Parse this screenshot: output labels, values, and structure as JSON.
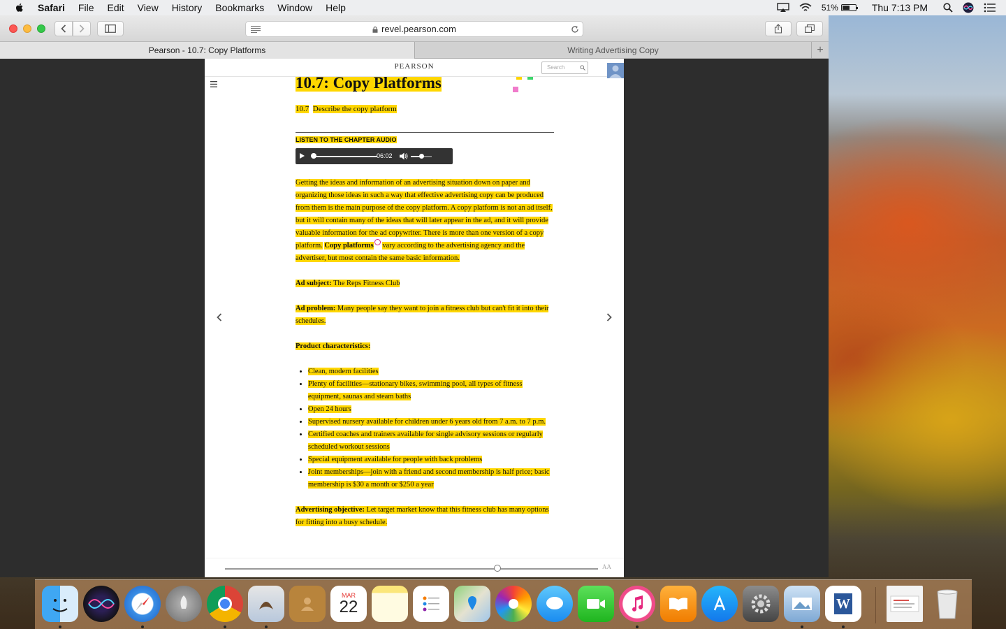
{
  "menubar": {
    "app_name": "Safari",
    "items": [
      "File",
      "Edit",
      "View",
      "History",
      "Bookmarks",
      "Window",
      "Help"
    ],
    "battery_percent": "51%",
    "battery_level": 0.51,
    "clock": "Thu 7:13 PM",
    "icons": [
      "apple-icon",
      "airplay-icon",
      "wifi-icon",
      "battery-icon",
      "spotlight-icon",
      "siri-icon",
      "notification-center-icon"
    ]
  },
  "browser": {
    "url": "revel.pearson.com",
    "tabs": [
      {
        "label": "Pearson - 10.7: Copy Platforms",
        "active": true
      },
      {
        "label": "Writing Advertising Copy",
        "active": false
      }
    ],
    "new_tab_label": "+"
  },
  "page": {
    "brand": "PEARSON",
    "search_placeholder": "Search",
    "title": "10.7: Copy Platforms",
    "objective_number": "10.7",
    "objective_text": "Describe the copy platform",
    "listen_label": "LISTEN TO THE CHAPTER AUDIO",
    "audio_time": "06:02",
    "audio_progress": 0.02,
    "volume_level": 0.5,
    "intro": {
      "part1": "Getting the ideas and information of an advertising situation down on paper and organizing those ideas in such a way that effective advertising copy can be produced from them is the main purpose of the copy platform. A copy platform is not an ad itself, but it will contain many of the ideas that will later appear in the ad, and it will provide valuable information for the ad copywriter. There is more than one version of a copy platform.",
      "term": "Copy platforms",
      "part2": "vary according to the advertising agency and the advertiser, but most contain the same basic information."
    },
    "ad_subject_label": "Ad subject:",
    "ad_subject_value": "The Reps Fitness Club",
    "ad_problem_label": "Ad problem:",
    "ad_problem_value": "Many people say they want to join a fitness club but can't fit it into their schedules.",
    "product_label": "Product characteristics:",
    "product_items": [
      "Clean, modern facilities",
      "Plenty of facilities—stationary bikes, swimming pool, all types of fitness equipment, saunas and steam baths",
      "Open 24 hours",
      "Supervised nursery available for children under 6 years old from 7 a.m. to 7 p.m.",
      "Certified coaches and trainers available for single advisory sessions or regularly scheduled workout sessions",
      "Special equipment available for people with back problems",
      "Joint memberships—join with a friend and second membership is half price; basic membership is $30 a month or $250 a year"
    ],
    "objective_label": "Advertising objective:",
    "objective_value": "Let target market know that this fitness club has many options for fitting into a busy schedule.",
    "reading_progress": 0.73,
    "font_size_label": "AA",
    "highlight_color": "#ffd700"
  },
  "dock": {
    "calendar_month": "MAR",
    "calendar_day": "22",
    "apps": [
      "Finder",
      "Siri",
      "Safari",
      "Launchpad",
      "Chrome",
      "Mail",
      "Contacts",
      "Calendar",
      "Notes",
      "Reminders",
      "Maps",
      "Photos",
      "Messages",
      "FaceTime",
      "iTunes",
      "iBooks",
      "App Store",
      "System Preferences",
      "Preview",
      "Microsoft Word",
      "Downloads",
      "Trash"
    ]
  }
}
